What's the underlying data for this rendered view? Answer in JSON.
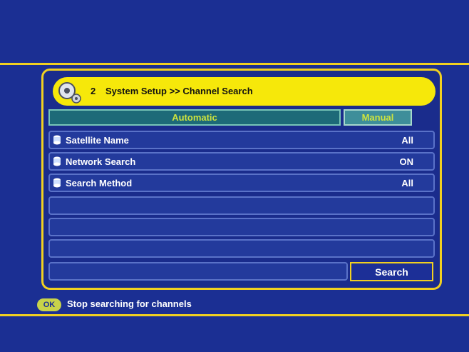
{
  "header": {
    "step_number": "2",
    "breadcrumb": "System Setup >> Channel Search"
  },
  "tabs": [
    {
      "label": "Automatic",
      "selected": false
    },
    {
      "label": "Manual",
      "selected": true
    }
  ],
  "settings": [
    {
      "label": "Satellite Name",
      "value": "All"
    },
    {
      "label": "Network Search",
      "value": "ON"
    },
    {
      "label": "Search Method",
      "value": "All"
    }
  ],
  "search_button": {
    "label": "Search"
  },
  "footer": {
    "key_label": "OK",
    "hint_text": "Stop searching for channels"
  },
  "colors": {
    "background": "#1b2f93",
    "accent": "#f1d021",
    "title_bar": "#f6e80a",
    "tab_text": "#cde33e"
  }
}
